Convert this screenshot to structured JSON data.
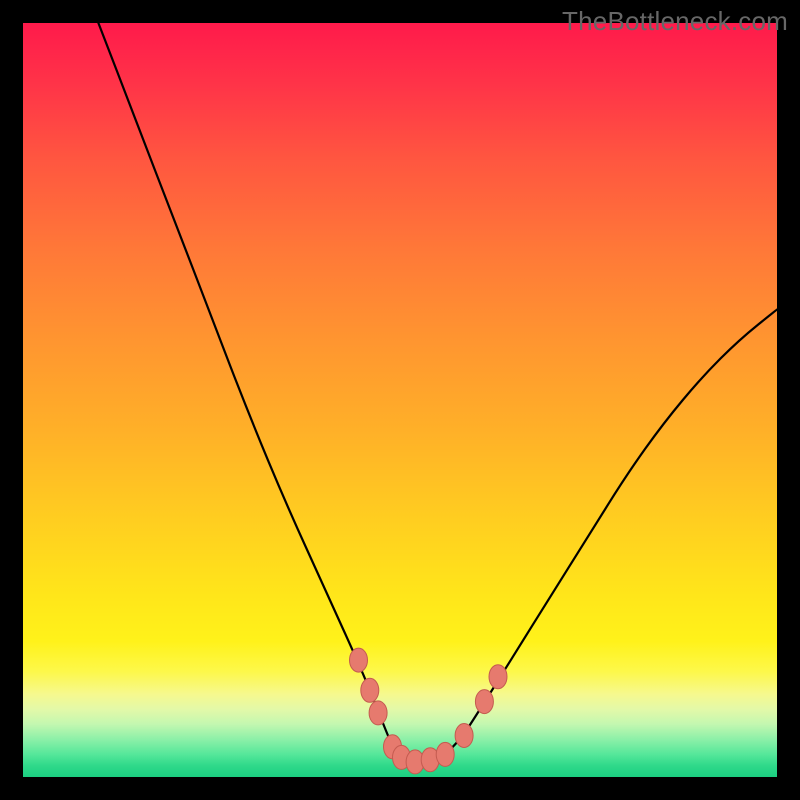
{
  "watermark": "TheBottleneck.com",
  "chart_data": {
    "type": "line",
    "title": "",
    "xlabel": "",
    "ylabel": "",
    "xlim": [
      0,
      100
    ],
    "ylim": [
      0,
      100
    ],
    "series": [
      {
        "name": "bottleneck-curve",
        "x": [
          10,
          15,
          20,
          25,
          30,
          35,
          40,
          45,
          47,
          49,
          50,
          52,
          54,
          56,
          58,
          60,
          65,
          70,
          75,
          80,
          85,
          90,
          95,
          100
        ],
        "y": [
          100,
          87,
          74,
          61,
          48,
          36,
          25,
          14,
          9,
          4,
          2,
          2,
          2,
          3,
          5,
          8,
          16,
          24,
          32,
          40,
          47,
          53,
          58,
          62
        ]
      }
    ],
    "markers": [
      {
        "name": "left-high",
        "x": 44.5,
        "y": 15.5
      },
      {
        "name": "left-mid",
        "x": 46.0,
        "y": 11.5
      },
      {
        "name": "left-low",
        "x": 47.1,
        "y": 8.5
      },
      {
        "name": "valley-l1",
        "x": 49.0,
        "y": 4.0
      },
      {
        "name": "valley-l2",
        "x": 50.2,
        "y": 2.6
      },
      {
        "name": "valley-c",
        "x": 52.0,
        "y": 2.0
      },
      {
        "name": "valley-r2",
        "x": 54.0,
        "y": 2.3
      },
      {
        "name": "valley-r1",
        "x": 56.0,
        "y": 3.0
      },
      {
        "name": "right-low",
        "x": 58.5,
        "y": 5.5
      },
      {
        "name": "right-mid",
        "x": 61.2,
        "y": 10.0
      },
      {
        "name": "right-high",
        "x": 63.0,
        "y": 13.3
      }
    ],
    "marker_style": {
      "fill": "#e67a6e",
      "stroke": "#c45b50",
      "rx": 9,
      "ry": 12
    },
    "curve_style": {
      "stroke": "#000000",
      "width": 2.2
    }
  }
}
